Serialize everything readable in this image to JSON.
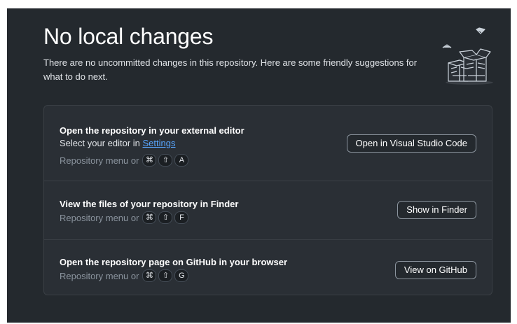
{
  "header": {
    "title": "No local changes",
    "subtitle": "There are no uncommitted changes in this repository. Here are some friendly suggestions for what to do next."
  },
  "illustration": {
    "icon": "empty-boxes-illustration"
  },
  "suggestions": [
    {
      "title": "Open the repository in your external editor",
      "sub_prefix": "Select your editor in ",
      "sub_link": "Settings",
      "shortcut_text": "Repository menu or",
      "keys": [
        "⌘",
        "⇧",
        "A"
      ],
      "button": "Open in Visual Studio Code"
    },
    {
      "title": "View the files of your repository in Finder",
      "shortcut_text": "Repository menu or",
      "keys": [
        "⌘",
        "⇧",
        "F"
      ],
      "button": "Show in Finder"
    },
    {
      "title": "Open the repository page on GitHub in your browser",
      "shortcut_text": "Repository menu or",
      "keys": [
        "⌘",
        "⇧",
        "G"
      ],
      "button": "View on GitHub"
    }
  ],
  "colors": {
    "background": "#24292e",
    "card": "#2a2f35",
    "link": "#58a6ff"
  }
}
